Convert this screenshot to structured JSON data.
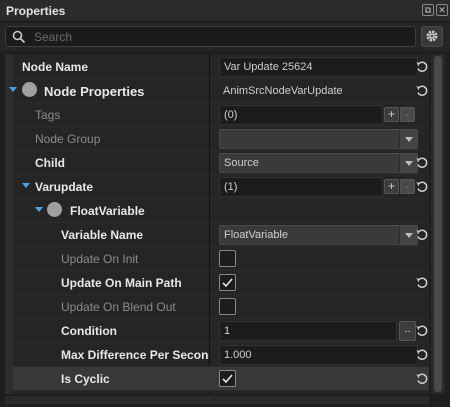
{
  "window": {
    "title": "Properties"
  },
  "search": {
    "placeholder": "Search"
  },
  "rows": {
    "node_name": {
      "label": "Node Name",
      "value": "Var Update 25624"
    },
    "node_properties": {
      "label": "Node Properties",
      "value": "AnimSrcNodeVarUpdate"
    },
    "tags": {
      "label": "Tags",
      "value": "(0)"
    },
    "node_group": {
      "label": "Node Group",
      "value": ""
    },
    "child": {
      "label": "Child",
      "value": "Source"
    },
    "varupdate": {
      "label": "Varupdate",
      "value": "(1)"
    },
    "floatvariable": {
      "label": "FloatVariable"
    },
    "variable_name": {
      "label": "Variable Name",
      "value": "FloatVariable"
    },
    "update_on_init": {
      "label": "Update On Init",
      "checked": false
    },
    "update_on_main_path": {
      "label": "Update On Main Path",
      "checked": true
    },
    "update_on_blend_out": {
      "label": "Update On Blend Out",
      "checked": false
    },
    "condition": {
      "label": "Condition",
      "value": "1"
    },
    "max_difference": {
      "label": "Max Difference Per Second",
      "value": "1.000"
    },
    "is_cyclic": {
      "label": "Is Cyclic",
      "checked": true
    }
  },
  "buttons": {
    "add": "+",
    "remove": "-",
    "browse": ".."
  },
  "colors": {
    "accent": "#4aa2e8",
    "background": "#1e1e1e",
    "panel": "#252525",
    "selected_row": "#383838"
  }
}
